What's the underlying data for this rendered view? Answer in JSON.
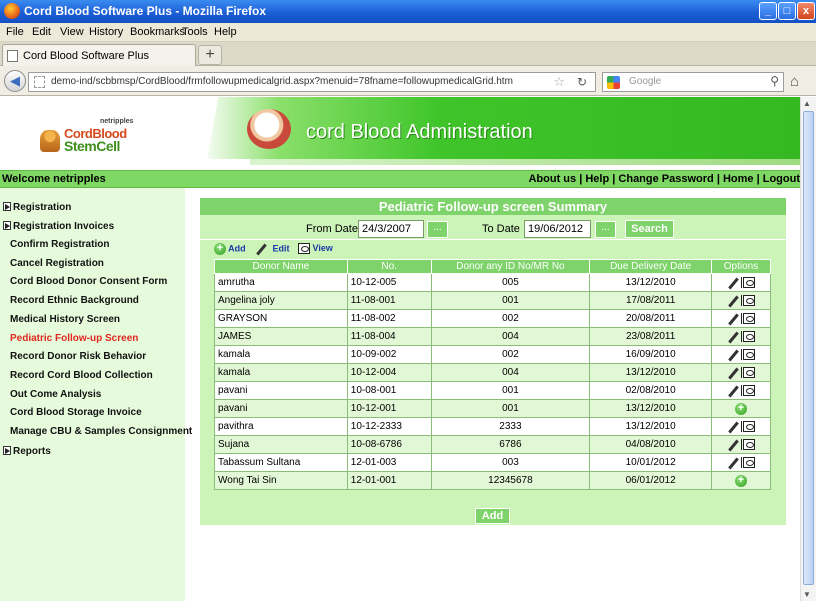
{
  "window": {
    "title": "Cord Blood Software Plus - Mozilla Firefox",
    "min": "_",
    "max": "□",
    "close": "x"
  },
  "menu": [
    "File",
    "Edit",
    "View",
    "History",
    "Bookmarks",
    "Tools",
    "Help"
  ],
  "tab": {
    "label": "Cord Blood Software Plus",
    "new_tab": "+"
  },
  "nav": {
    "url": "demo-ind/scbbmsp/CordBlood/frmfollowupmedicalgrid.aspx?menuid=78fname=followupmedicalGrid.htm",
    "search_placeholder": "Google"
  },
  "banner": {
    "logo_small": "netripples",
    "logo_line1": "CordBlood",
    "logo_line2": "StemCell",
    "title": "cord Blood Administration"
  },
  "welcome": "Welcome netripples",
  "toplinks": [
    "About us",
    "Help",
    "Change Password",
    "Home",
    "Logout"
  ],
  "sidebar": {
    "items": [
      {
        "label": "Registration",
        "expander": true
      },
      {
        "label": "Registration Invoices",
        "expander": true
      },
      {
        "label": "Confirm Registration"
      },
      {
        "label": "Cancel Registration"
      },
      {
        "label": "Cord Blood Donor Consent Form"
      },
      {
        "label": "Record Ethnic Background"
      },
      {
        "label": "Medical History Screen"
      },
      {
        "label": "Pediatric Follow-up Screen",
        "active": true
      },
      {
        "label": "Record Donor Risk Behavior"
      },
      {
        "label": "Record Cord Blood Collection"
      },
      {
        "label": "Out Come Analysis"
      },
      {
        "label": "Cord Blood Storage Invoice"
      },
      {
        "label": "Manage CBU & Samples Consignment"
      },
      {
        "label": "Reports",
        "expander": true
      }
    ]
  },
  "summary": {
    "title": "Pediatric Follow-up screen Summary",
    "from_label": "From Date",
    "from_value": "24/3/2007",
    "to_label": "To Date",
    "to_value": "19/06/2012",
    "picker_label": "...",
    "search_label": "Search",
    "add_label": "Add",
    "edit_label": "Edit",
    "view_label": "View",
    "add_button": "Add"
  },
  "table": {
    "headers": [
      "Donor Name",
      "No.",
      "Donor any ID No/MR No",
      "Due Delivery Date",
      "Options"
    ],
    "rows": [
      {
        "name": "amrutha",
        "no": "10-12-005",
        "id": "005",
        "date": "13/12/2010",
        "opt": "edit-view"
      },
      {
        "name": "Angelina joly",
        "no": "11-08-001",
        "id": "001",
        "date": "17/08/2011",
        "opt": "edit-view"
      },
      {
        "name": "GRAYSON",
        "no": "11-08-002",
        "id": "002",
        "date": "20/08/2011",
        "opt": "edit-view"
      },
      {
        "name": "JAMES",
        "no": "11-08-004",
        "id": "004",
        "date": "23/08/2011",
        "opt": "edit-view"
      },
      {
        "name": "kamala",
        "no": "10-09-002",
        "id": "002",
        "date": "16/09/2010",
        "opt": "edit-view"
      },
      {
        "name": "kamala",
        "no": "10-12-004",
        "id": "004",
        "date": "13/12/2010",
        "opt": "edit-view"
      },
      {
        "name": "pavani",
        "no": "10-08-001",
        "id": "001",
        "date": "02/08/2010",
        "opt": "edit-view"
      },
      {
        "name": "pavani",
        "no": "10-12-001",
        "id": "001",
        "date": "13/12/2010",
        "opt": "add"
      },
      {
        "name": "pavithra",
        "no": "10-12-2333",
        "id": "2333",
        "date": "13/12/2010",
        "opt": "edit-view"
      },
      {
        "name": "Sujana",
        "no": "10-08-6786",
        "id": "6786",
        "date": "04/08/2010",
        "opt": "edit-view"
      },
      {
        "name": "Tabassum Sultana",
        "no": "12-01-003",
        "id": "003",
        "date": "10/01/2012",
        "opt": "edit-view"
      },
      {
        "name": "Wong Tai Sin",
        "no": "12-01-001",
        "id": "12345678",
        "date": "06/01/2012",
        "opt": "add"
      }
    ]
  },
  "colors": {
    "accent_green": "#7ed36b",
    "panel_green": "#ccf3b8",
    "active_red": "#e0281e"
  }
}
